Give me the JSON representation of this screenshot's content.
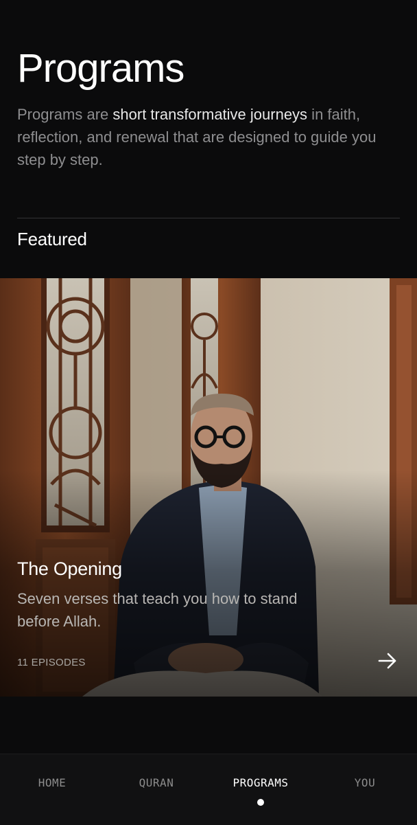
{
  "header": {
    "title": "Programs",
    "intro_before": "Programs are ",
    "intro_highlight": "short transformative journeys",
    "intro_after": " in faith, reflection, and renewal that are designed to guide you step by step."
  },
  "featured": {
    "section_label": "Featured",
    "card": {
      "title": "The Opening",
      "description": "Seven verses that teach you how to stand before Allah.",
      "episodes": "11 EPISODES",
      "arrow_icon": "arrow-right-icon"
    }
  },
  "tabbar": {
    "tabs": [
      {
        "label": "HOME"
      },
      {
        "label": "QURAN"
      },
      {
        "label": "PROGRAMS"
      },
      {
        "label": "YOU"
      }
    ],
    "active": "PROGRAMS"
  },
  "colors": {
    "background": "#0b0b0c",
    "muted_text": "#8e8e90",
    "highlight_text": "#e8e8e8",
    "active_tab": "#ffffff",
    "inactive_tab": "#8c8c8c"
  }
}
